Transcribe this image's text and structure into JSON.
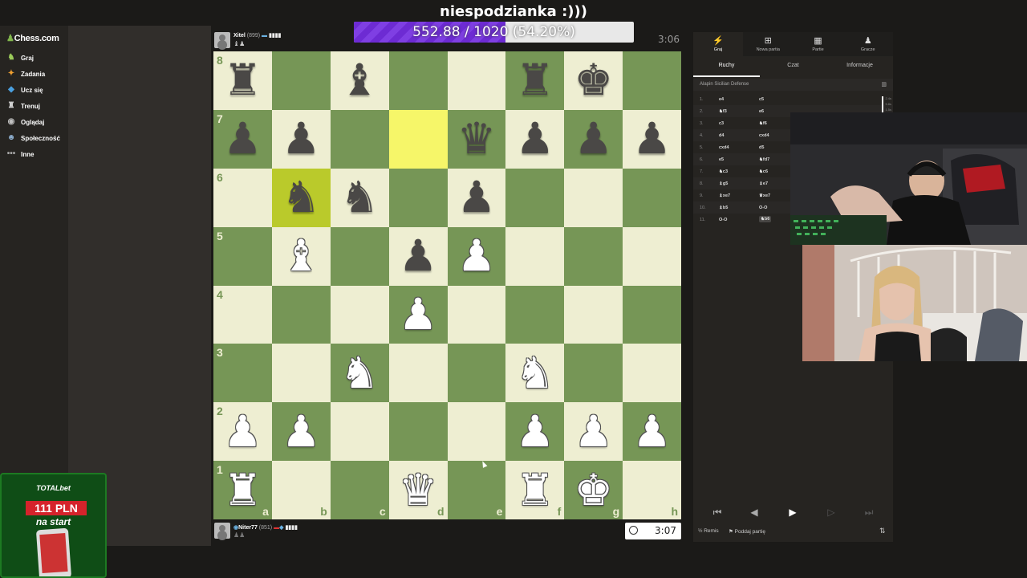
{
  "stream": {
    "title": "niespodzianka :)))",
    "goal_text": "552.88 / 1020 (54.20%)",
    "goal_fraction": 0.542
  },
  "sidebar": {
    "logo": "Chess.com",
    "items": [
      {
        "label": "Graj",
        "icon": "play-icon"
      },
      {
        "label": "Zadania",
        "icon": "puzzle-icon"
      },
      {
        "label": "Ucz się",
        "icon": "learn-icon"
      },
      {
        "label": "Trenuj",
        "icon": "train-icon"
      },
      {
        "label": "Oglądaj",
        "icon": "watch-icon"
      },
      {
        "label": "Społeczność",
        "icon": "community-icon"
      },
      {
        "label": "Inne",
        "icon": "more-icon"
      }
    ]
  },
  "players": {
    "top": {
      "name": "Xitel",
      "rating": "(899)",
      "captured": "♝♟",
      "clock": "3:06"
    },
    "bottom": {
      "name": "Niter77",
      "rating": "(851)",
      "captured": "♟♟",
      "clock": "3:07"
    }
  },
  "board": {
    "ranks": [
      "8",
      "7",
      "6",
      "5",
      "4",
      "3",
      "2",
      "1"
    ],
    "files": [
      "a",
      "b",
      "c",
      "d",
      "e",
      "f",
      "g",
      "h"
    ],
    "highlighted": [
      "d7",
      "b6"
    ],
    "position": {
      "a8": "br",
      "c8": "bb",
      "f8": "br",
      "g8": "bk",
      "a7": "bp",
      "b7": "bp",
      "e7": "bq",
      "f7": "bp",
      "g7": "bp",
      "h7": "bp",
      "b6": "bn",
      "c6": "bn",
      "e6": "bp",
      "b5": "wb",
      "d5": "bp",
      "e5": "wp",
      "d4": "wp",
      "c3": "wn",
      "f3": "wn",
      "a2": "wp",
      "b2": "wp",
      "f2": "wp",
      "g2": "wp",
      "h2": "wp",
      "a1": "wr",
      "d1": "wq",
      "f1": "wr",
      "g1": "wk"
    }
  },
  "right_panel": {
    "tabs": [
      {
        "label": "Graj",
        "icon": "bolt-icon"
      },
      {
        "label": "Nowa partia",
        "icon": "plus-icon"
      },
      {
        "label": "Partie",
        "icon": "board-icon"
      },
      {
        "label": "Gracze",
        "icon": "players-icon"
      }
    ],
    "subtabs": [
      "Ruchy",
      "Czat",
      "Informacje"
    ],
    "opening": "Alapin Sicilian Defense",
    "moves": [
      {
        "n": "1.",
        "w": "e4",
        "b": "c5"
      },
      {
        "n": "2.",
        "w": "♞f3",
        "b": "e6"
      },
      {
        "n": "3.",
        "w": "c3",
        "b": "♞f6"
      },
      {
        "n": "4.",
        "w": "d4",
        "b": "cxd4"
      },
      {
        "n": "5.",
        "w": "cxd4",
        "b": "d5"
      },
      {
        "n": "6.",
        "w": "e5",
        "b": "♞fd7"
      },
      {
        "n": "7.",
        "w": "♞c3",
        "b": "♞c6"
      },
      {
        "n": "8.",
        "w": "♝g5",
        "b": "♝e7"
      },
      {
        "n": "9.",
        "w": "♝xe7",
        "b": "♛xe7"
      },
      {
        "n": "10.",
        "w": "♝b5",
        "b": "O-O"
      },
      {
        "n": "11.",
        "w": "O-O",
        "b": "♞b6"
      }
    ],
    "eval_labels": [
      "2.4s",
      "5.8s",
      "1.5s"
    ],
    "draw_label": "Remis",
    "resign_label": "Poddaj partię"
  },
  "sponsor": {
    "brand": "TOTALbet",
    "amount": "111 PLN",
    "subtitle": "na start"
  },
  "colors": {
    "light_square": "#eeeed2",
    "dark_square": "#769656",
    "accent_green": "#81b64c",
    "goal_purple": "#6d2bd3"
  }
}
